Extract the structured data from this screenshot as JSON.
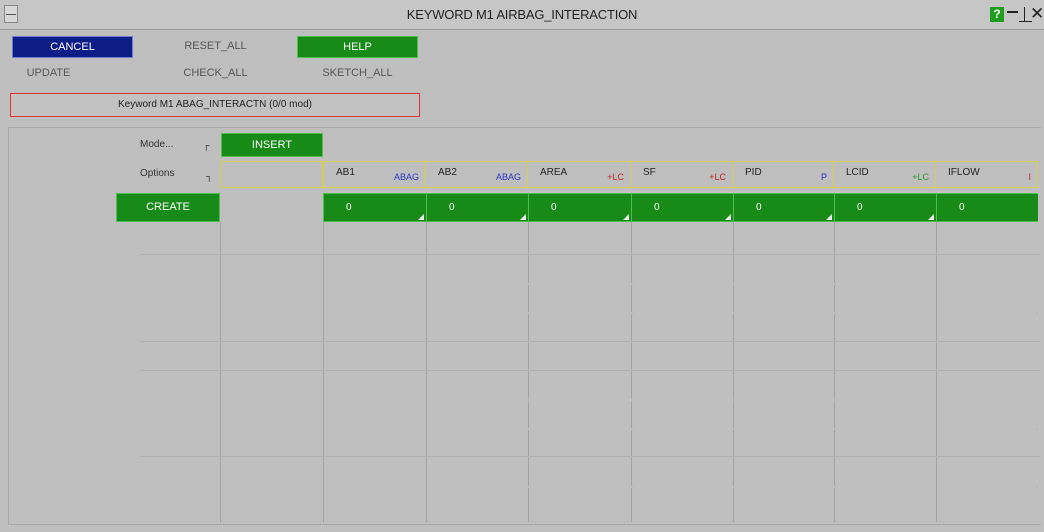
{
  "window": {
    "title": "KEYWORD M1 AIRBAG_INTERACTION"
  },
  "toolbar": {
    "cancel": "CANCEL",
    "reset_all": "RESET_ALL",
    "help": "HELP",
    "update": "UPDATE",
    "check_all": "CHECK_ALL",
    "sketch_all": "SKETCH_ALL"
  },
  "status": "Keyword M1 ABAG_INTERACTN (0/0 mod)",
  "form": {
    "mode_label": "Mode...",
    "mode_value": "INSERT",
    "options_label": "Options",
    "create_label": "CREATE"
  },
  "columns": [
    {
      "name": "AB1",
      "type": "ABAG",
      "type_color": "#2a36c8",
      "value": "0"
    },
    {
      "name": "AB2",
      "type": "ABAG",
      "type_color": "#2a36c8",
      "value": "0"
    },
    {
      "name": "AREA",
      "type": "+LC",
      "type_color": "#c22020",
      "value": "0"
    },
    {
      "name": "SF",
      "type": "+LC",
      "type_color": "#c22020",
      "value": "0"
    },
    {
      "name": "PID",
      "type": "P",
      "type_color": "#2a36c8",
      "value": "0"
    },
    {
      "name": "LCID",
      "type": "+LC",
      "type_color": "#2a9a2a",
      "value": "0"
    },
    {
      "name": "IFLOW",
      "type": "I",
      "type_color": "#c22020",
      "value": "0"
    }
  ],
  "icons": {
    "system_menu": "system-menu-icon",
    "help": "?",
    "mode_popup": "┌",
    "options_popup": "┐"
  }
}
